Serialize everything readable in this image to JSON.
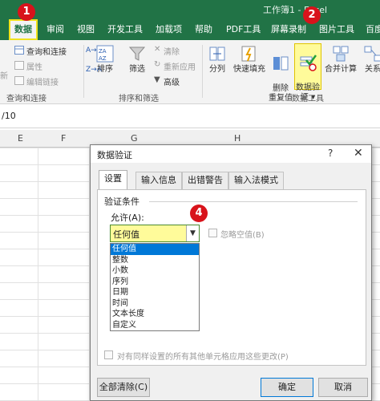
{
  "window": {
    "title": "工作簿1 - Excel"
  },
  "tabs": [
    "数据",
    "审阅",
    "视图",
    "开发工具",
    "加载项",
    "帮助",
    "PDF工具",
    "屏幕录制",
    "图片工具",
    "百度"
  ],
  "ribbon": {
    "query_group": {
      "items": [
        "查询和连接",
        "属性",
        "编辑链接"
      ],
      "label": "查询和连接",
      "left_cut": "新"
    },
    "sort_filter": {
      "az": "A→Z",
      "za": "Z→A",
      "sort": "排序",
      "filter": "筛选",
      "clear": "清除",
      "reapply": "重新应用",
      "advanced": "高级",
      "label": "排序和筛选"
    },
    "data_tools": {
      "split": "分列",
      "flash_fill": "快速填充",
      "remove_dup": "删除\n重复值",
      "validation": "数据验\n证 ▾",
      "consolidate": "合并计算",
      "label": "数据工具"
    },
    "relations": "关系"
  },
  "formula_bar": {
    "text": "/10"
  },
  "columns": [
    "E",
    "F",
    "G",
    "H"
  ],
  "annotations": [
    "1",
    "2",
    "4"
  ],
  "dialog": {
    "title": "数据验证",
    "help": "?",
    "close": "✕",
    "tabs": [
      "设置",
      "输入信息",
      "出错警告",
      "输入法模式"
    ],
    "section": "验证条件",
    "allow_label": "允许(A):",
    "allow_value": "任何值",
    "ignore_blank": "忽略空值(B)",
    "options": [
      "任何值",
      "整数",
      "小数",
      "序列",
      "日期",
      "时间",
      "文本长度",
      "自定义"
    ],
    "apply_all": "对有同样设置的所有其他单元格应用这些更改(P)",
    "clear_all": "全部清除(C)",
    "ok": "确定",
    "cancel": "取消"
  },
  "colors": {
    "excel_green": "#217346",
    "annotation_red": "#d8131b",
    "highlight_yellow": "#fffb9a",
    "selection_blue": "#0078d7"
  }
}
